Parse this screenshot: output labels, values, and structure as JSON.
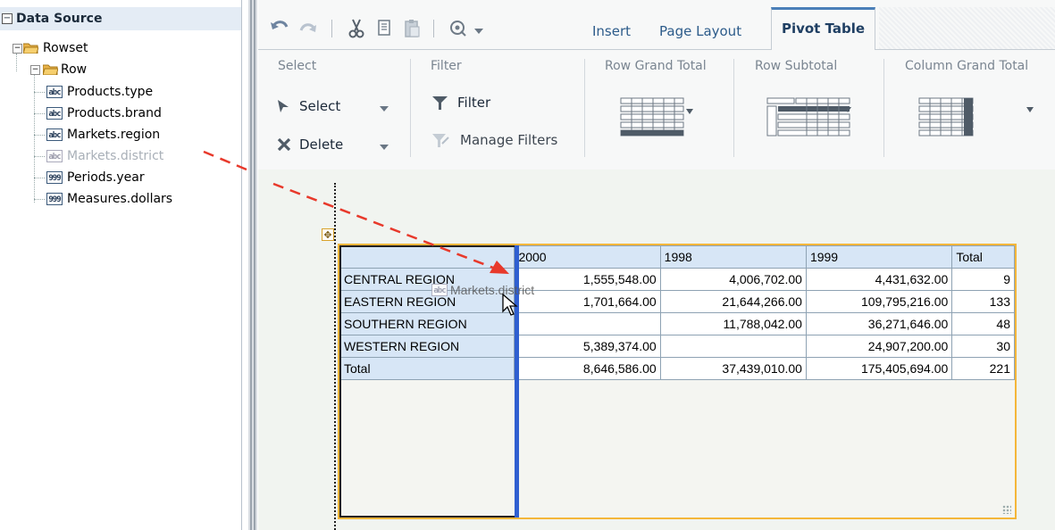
{
  "data_source": {
    "title": "Data Source",
    "tree": {
      "root_label": "Rowset",
      "row_label": "Row",
      "fields": [
        {
          "label": "Products.type",
          "icon": "abc",
          "dimmed": false
        },
        {
          "label": "Products.brand",
          "icon": "abc",
          "dimmed": false
        },
        {
          "label": "Markets.region",
          "icon": "abc",
          "dimmed": false
        },
        {
          "label": "Markets.district",
          "icon": "abc",
          "dimmed": true
        },
        {
          "label": "Periods.year",
          "icon": "999",
          "dimmed": false
        },
        {
          "label": "Measures.dollars",
          "icon": "999",
          "dimmed": false
        }
      ]
    }
  },
  "ribbon": {
    "tabs": [
      {
        "label": "Insert",
        "active": false
      },
      {
        "label": "Page Layout",
        "active": false
      },
      {
        "label": "Pivot Table",
        "active": true
      }
    ],
    "toolbar_icons": [
      "undo-icon",
      "redo-icon",
      "cut-icon",
      "copy-icon",
      "paste-icon",
      "preview-icon"
    ],
    "groups": {
      "select": {
        "label": "Select",
        "select_btn": "Select",
        "delete_btn": "Delete"
      },
      "filter": {
        "label": "Filter",
        "filter_btn": "Filter",
        "manage_btn": "Manage Filters"
      },
      "row_grand_total": {
        "label": "Row Grand Total"
      },
      "row_subtotal": {
        "label": "Row Subtotal"
      },
      "column_grand_total": {
        "label": "Column Grand Total"
      }
    }
  },
  "pivot": {
    "columns": [
      "2000",
      "1998",
      "1999",
      "Total"
    ],
    "rows": [
      {
        "label": "CENTRAL REGION",
        "values": [
          "1,555,548.00",
          "4,006,702.00",
          "4,431,632.00",
          "9"
        ]
      },
      {
        "label": "EASTERN REGION",
        "values": [
          "1,701,664.00",
          "21,644,266.00",
          "109,795,216.00",
          "133"
        ]
      },
      {
        "label": "SOUTHERN REGION",
        "values": [
          "",
          "11,788,042.00",
          "36,271,646.00",
          "48"
        ]
      },
      {
        "label": "WESTERN REGION",
        "values": [
          "5,389,374.00",
          "",
          "24,907,200.00",
          "30"
        ]
      },
      {
        "label": "Total",
        "values": [
          "8,646,586.00",
          "37,439,010.00",
          "175,405,694.00",
          "221"
        ]
      }
    ]
  },
  "drag": {
    "ghost_label": "Markets.district",
    "ghost_icon": "abc"
  },
  "colors": {
    "header_cell": "#d7e6f6",
    "selection_border": "#f4b63a",
    "drop_indicator": "#2f5fd0",
    "drag_arrow": "#e8392b",
    "tab_accent": "#4a7fb8"
  }
}
